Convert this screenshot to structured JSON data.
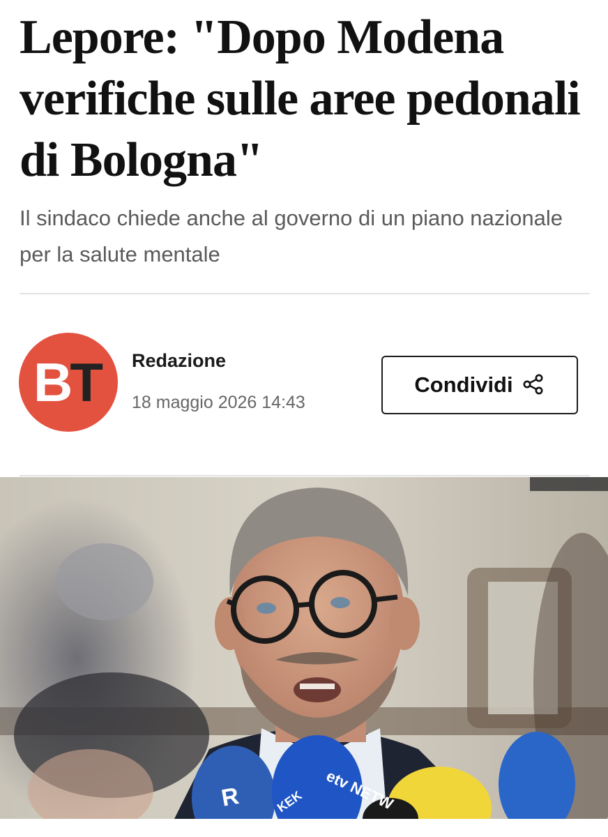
{
  "article": {
    "headline": "Lepore: \"Dopo Modena verifiche sulle aree pedonali di Bologna\"",
    "subtitle": "Il sindaco chiede anche al governo di un piano nazionale per la salute mentale"
  },
  "byline": {
    "logo_letters": {
      "first": "B",
      "second": "T"
    },
    "author": "Redazione",
    "date": "18 maggio 2026 14:43"
  },
  "share": {
    "label": "Condividi",
    "icon": "share-icon"
  },
  "photo": {
    "mic_labels": [
      "R",
      "KEK",
      "etv NETW"
    ]
  },
  "colors": {
    "logo_background": "#e3513f",
    "headline": "#111111",
    "subtitle": "#5a5a5a",
    "date": "#666666"
  }
}
